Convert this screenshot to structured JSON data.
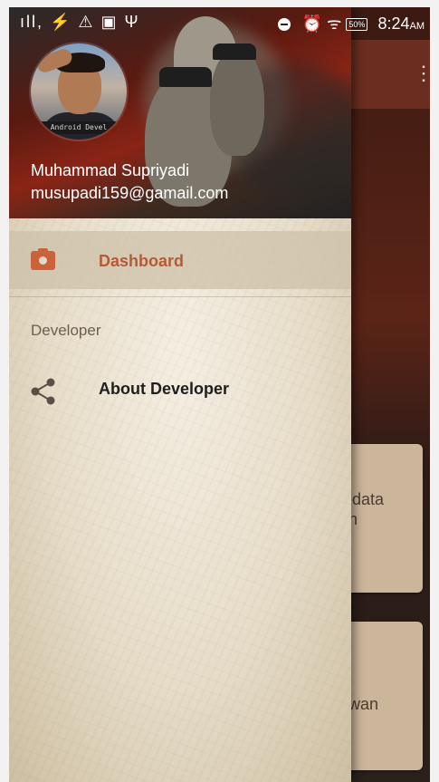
{
  "status_bar": {
    "left_icons": "ıll, ⚡ ⚠ ▣ Ψ",
    "battery": "50%",
    "time": "8:24",
    "ampm": "AM"
  },
  "header": {
    "avatar_banner": "Android Devel",
    "user_name": "Muhammad Supriyadi",
    "user_email": "musupadi159@gamail.com"
  },
  "menu": {
    "dashboard_label": "Dashboard",
    "section_title": "Developer",
    "about_label": "About Developer"
  },
  "background_app": {
    "card1_text": "iodata\nan",
    "card2_text": "awan"
  },
  "colors": {
    "active_accent": "#b55a35",
    "camera_icon": "#c8633c"
  }
}
